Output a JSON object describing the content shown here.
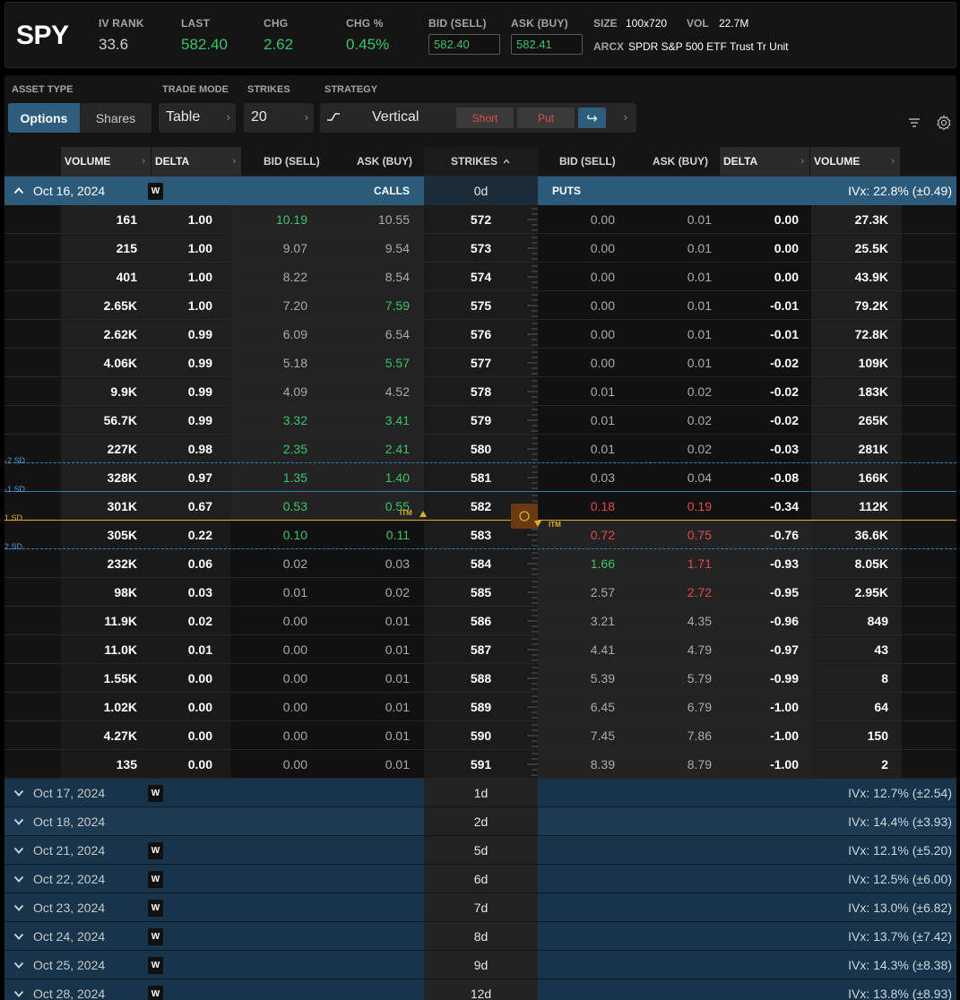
{
  "header": {
    "symbol": "SPY",
    "iv_rank_label": "IV RANK",
    "iv_rank": "33.6",
    "last_label": "LAST",
    "last": "582.40",
    "chg_label": "CHG",
    "chg": "2.62",
    "chg_pct_label": "CHG %",
    "chg_pct": "0.45%",
    "bid_label": "BID (SELL)",
    "bid": "582.40",
    "ask_label": "ASK (BUY)",
    "ask": "582.41",
    "size_label": "SIZE",
    "size": "100x720",
    "vol_label": "VOL",
    "vol": "22.7M",
    "exchange": "ARCX",
    "description": "SPDR S&P 500 ETF Trust Tr Unit"
  },
  "controls": {
    "asset_type_label": "ASSET TYPE",
    "asset_options": "Options",
    "asset_shares": "Shares",
    "trade_mode_label": "TRADE MODE",
    "trade_mode": "Table",
    "strikes_label": "STRIKES",
    "strikes": "20",
    "strategy_label": "STRATEGY",
    "strategy": "Vertical",
    "short": "Short",
    "put": "Put",
    "arrow": "↪"
  },
  "columns": {
    "c_volume": "VOLUME",
    "c_delta": "DELTA",
    "c_bid": "BID (SELL)",
    "c_ask": "ASK (BUY)",
    "strikes": "STRIKES",
    "strikes_sort": "^",
    "p_bid": "BID (SELL)",
    "p_ask": "ASK (BUY)",
    "p_delta": "DELTA",
    "p_volume": "VOLUME"
  },
  "open_expiry": {
    "date": "Oct 16, 2024",
    "badge": "W",
    "calls": "CALLS",
    "dte": "0d",
    "puts": "PUTS",
    "ivx": "IVx: 22.8% (±0.49)"
  },
  "markers": {
    "sd_minus2": "-2 SD",
    "sd_minus1": "-1 SD",
    "sd_plus1": "1 SD",
    "sd_plus2": "2 SD",
    "itm": "ITM"
  },
  "rows": [
    {
      "cvol": "161",
      "cdel": "1.00",
      "cbid": "10.19",
      "cask": "10.55",
      "strike": "572",
      "pbid": "0.00",
      "pask": "0.01",
      "pdel": "0.00",
      "pvol": "27.3K"
    },
    {
      "cvol": "215",
      "cdel": "1.00",
      "cbid": "9.07",
      "cask": "9.54",
      "strike": "573",
      "pbid": "0.00",
      "pask": "0.01",
      "pdel": "0.00",
      "pvol": "25.5K"
    },
    {
      "cvol": "401",
      "cdel": "1.00",
      "cbid": "8.22",
      "cask": "8.54",
      "strike": "574",
      "pbid": "0.00",
      "pask": "0.01",
      "pdel": "0.00",
      "pvol": "43.9K"
    },
    {
      "cvol": "2.65K",
      "cdel": "1.00",
      "cbid": "7.20",
      "cask": "7.59",
      "strike": "575",
      "pbid": "0.00",
      "pask": "0.01",
      "pdel": "-0.01",
      "pvol": "79.2K"
    },
    {
      "cvol": "2.62K",
      "cdel": "0.99",
      "cbid": "6.09",
      "cask": "6.54",
      "strike": "576",
      "pbid": "0.00",
      "pask": "0.01",
      "pdel": "-0.01",
      "pvol": "72.8K"
    },
    {
      "cvol": "4.06K",
      "cdel": "0.99",
      "cbid": "5.18",
      "cask": "5.57",
      "strike": "577",
      "pbid": "0.00",
      "pask": "0.01",
      "pdel": "-0.02",
      "pvol": "109K"
    },
    {
      "cvol": "9.9K",
      "cdel": "0.99",
      "cbid": "4.09",
      "cask": "4.52",
      "strike": "578",
      "pbid": "0.01",
      "pask": "0.02",
      "pdel": "-0.02",
      "pvol": "183K"
    },
    {
      "cvol": "56.7K",
      "cdel": "0.99",
      "cbid": "3.32",
      "cask": "3.41",
      "strike": "579",
      "pbid": "0.01",
      "pask": "0.02",
      "pdel": "-0.02",
      "pvol": "265K"
    },
    {
      "cvol": "227K",
      "cdel": "0.98",
      "cbid": "2.35",
      "cask": "2.41",
      "strike": "580",
      "pbid": "0.01",
      "pask": "0.02",
      "pdel": "-0.03",
      "pvol": "281K"
    },
    {
      "cvol": "328K",
      "cdel": "0.97",
      "cbid": "1.35",
      "cask": "1.40",
      "strike": "581",
      "pbid": "0.03",
      "pask": "0.04",
      "pdel": "-0.08",
      "pvol": "166K"
    },
    {
      "cvol": "301K",
      "cdel": "0.67",
      "cbid": "0.53",
      "cask": "0.55",
      "strike": "582",
      "pbid": "0.18",
      "pask": "0.19",
      "pdel": "-0.34",
      "pvol": "112K"
    },
    {
      "cvol": "305K",
      "cdel": "0.22",
      "cbid": "0.10",
      "cask": "0.11",
      "strike": "583",
      "pbid": "0.72",
      "pask": "0.75",
      "pdel": "-0.76",
      "pvol": "36.6K"
    },
    {
      "cvol": "232K",
      "cdel": "0.06",
      "cbid": "0.02",
      "cask": "0.03",
      "strike": "584",
      "pbid": "1.66",
      "pask": "1.71",
      "pdel": "-0.93",
      "pvol": "8.05K"
    },
    {
      "cvol": "98K",
      "cdel": "0.03",
      "cbid": "0.01",
      "cask": "0.02",
      "strike": "585",
      "pbid": "2.57",
      "pask": "2.72",
      "pdel": "-0.95",
      "pvol": "2.95K"
    },
    {
      "cvol": "11.9K",
      "cdel": "0.02",
      "cbid": "0.00",
      "cask": "0.01",
      "strike": "586",
      "pbid": "3.21",
      "pask": "4.35",
      "pdel": "-0.96",
      "pvol": "849"
    },
    {
      "cvol": "11.0K",
      "cdel": "0.01",
      "cbid": "0.00",
      "cask": "0.01",
      "strike": "587",
      "pbid": "4.41",
      "pask": "4.79",
      "pdel": "-0.97",
      "pvol": "43"
    },
    {
      "cvol": "1.55K",
      "cdel": "0.00",
      "cbid": "0.00",
      "cask": "0.01",
      "strike": "588",
      "pbid": "5.39",
      "pask": "5.79",
      "pdel": "-0.99",
      "pvol": "8"
    },
    {
      "cvol": "1.02K",
      "cdel": "0.00",
      "cbid": "0.00",
      "cask": "0.01",
      "strike": "589",
      "pbid": "6.45",
      "pask": "6.79",
      "pdel": "-1.00",
      "pvol": "64"
    },
    {
      "cvol": "4.27K",
      "cdel": "0.00",
      "cbid": "0.00",
      "cask": "0.01",
      "strike": "590",
      "pbid": "7.45",
      "pask": "7.86",
      "pdel": "-1.00",
      "pvol": "150"
    },
    {
      "cvol": "135",
      "cdel": "0.00",
      "cbid": "0.00",
      "cask": "0.01",
      "strike": "591",
      "pbid": "8.39",
      "pask": "8.79",
      "pdel": "-1.00",
      "pvol": "2"
    }
  ],
  "expirations": [
    {
      "date": "Oct 17, 2024",
      "badge": "W",
      "dte": "1d",
      "ivx": "IVx: 12.7% (±2.54)"
    },
    {
      "date": "Oct 18, 2024",
      "badge": "",
      "dte": "2d",
      "ivx": "IVx: 14.4% (±3.93)"
    },
    {
      "date": "Oct 21, 2024",
      "badge": "W",
      "dte": "5d",
      "ivx": "IVx: 12.1% (±5.20)"
    },
    {
      "date": "Oct 22, 2024",
      "badge": "W",
      "dte": "6d",
      "ivx": "IVx: 12.5% (±6.00)"
    },
    {
      "date": "Oct 23, 2024",
      "badge": "W",
      "dte": "7d",
      "ivx": "IVx: 13.0% (±6.82)"
    },
    {
      "date": "Oct 24, 2024",
      "badge": "W",
      "dte": "8d",
      "ivx": "IVx: 13.7% (±7.42)"
    },
    {
      "date": "Oct 25, 2024",
      "badge": "W",
      "dte": "9d",
      "ivx": "IVx: 14.3% (±8.38)"
    },
    {
      "date": "Oct 28, 2024",
      "badge": "W",
      "dte": "12d",
      "ivx": "IVx: 13.8% (±8.93)"
    }
  ],
  "colors": {
    "green": "#39c36a",
    "red": "#e24b4b",
    "accent": "#2d5c7d",
    "price_line": "#e0b020",
    "sd_line": "#2f7fb5"
  }
}
